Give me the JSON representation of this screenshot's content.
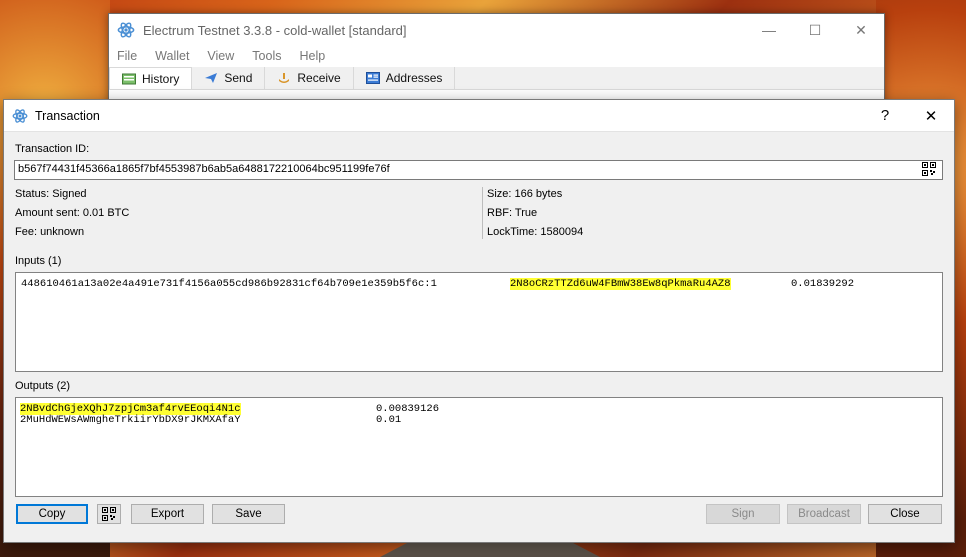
{
  "main_window": {
    "title": "Electrum Testnet 3.3.8  -  cold-wallet  [standard]",
    "menu": [
      "File",
      "Wallet",
      "View",
      "Tools",
      "Help"
    ],
    "tabs": [
      {
        "label": "History",
        "icon": "history-icon"
      },
      {
        "label": "Send",
        "icon": "send-icon"
      },
      {
        "label": "Receive",
        "icon": "receive-icon"
      },
      {
        "label": "Addresses",
        "icon": "addresses-icon"
      }
    ],
    "controls": {
      "minimize": "—",
      "maximize": "☐",
      "close": "✕"
    }
  },
  "dialog": {
    "title": "Transaction",
    "help": "?",
    "close": "✕",
    "txid_label": "Transaction ID:",
    "txid": "b567f74431f45366a1865f7bf4553987b6ab5a6488172210064bc951199fe76f",
    "status": "Status: Signed",
    "amount_sent": "Amount sent: 0.01 BTC",
    "fee": "Fee: unknown",
    "size": "Size: 166 bytes",
    "rbf": "RBF: True",
    "locktime": "LockTime: 1580094",
    "inputs_label": "Inputs (1)",
    "inputs": [
      {
        "prevout": "448610461a13a02e4a491e731f4156a055cd986b92831cf64b709e1e359b5f6c:1",
        "address": "2N8oCRzTTZd6uW4FBmW38Ew8qPkmaRu4AZ8",
        "amount": "0.01839292"
      }
    ],
    "outputs_label": "Outputs (2)",
    "outputs": [
      {
        "address": "2NBvdChGjeXQhJ7zpjCm3af4rvEEoqi4N1c",
        "amount": "0.00839126"
      },
      {
        "address": "2MuHdWEWsAWmgheTrkiirYbDX9rJKMXAfaY",
        "amount": "0.01"
      }
    ],
    "buttons": {
      "copy": "Copy",
      "export": "Export",
      "save": "Save",
      "sign": "Sign",
      "broadcast": "Broadcast",
      "close": "Close"
    }
  },
  "colors": {
    "highlight": "#ffff33",
    "focus_border": "#0078d7"
  }
}
